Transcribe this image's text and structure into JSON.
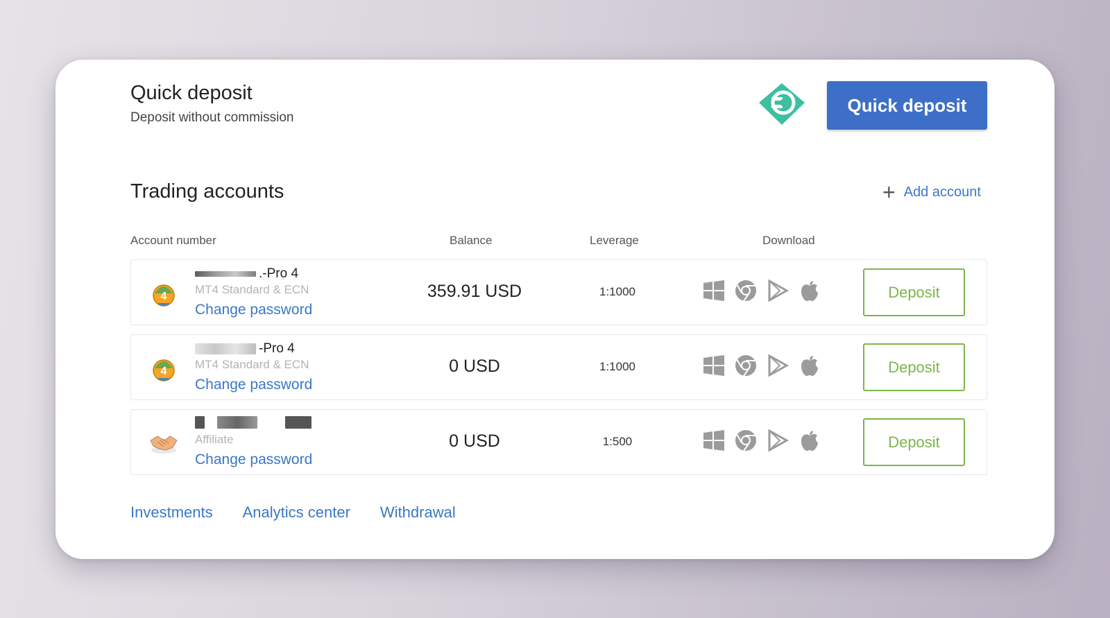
{
  "quick_deposit": {
    "title": "Quick deposit",
    "subtitle": "Deposit without commission",
    "button_label": "Quick deposit"
  },
  "trading": {
    "title": "Trading accounts",
    "add_account_label": "Add account",
    "columns": [
      "Account number",
      "Balance",
      "Leverage",
      "Download"
    ],
    "rows": [
      {
        "icon": "mt4-icon",
        "name_suffix": ".-Pro 4",
        "type": "MT4 Standard & ECN",
        "change_password": "Change password",
        "balance": "359.91 USD",
        "leverage": "1:1000",
        "deposit_label": "Deposit"
      },
      {
        "icon": "mt4-icon",
        "name_suffix": "-Pro 4",
        "type": "MT4 Standard & ECN",
        "change_password": "Change password",
        "balance": "0 USD",
        "leverage": "1:1000",
        "deposit_label": "Deposit"
      },
      {
        "icon": "handshake-icon",
        "name_suffix": "",
        "type": "Affiliate",
        "change_password": "Change password",
        "balance": "0 USD",
        "leverage": "1:500",
        "deposit_label": "Deposit"
      }
    ],
    "download_icons": [
      "windows-icon",
      "chrome-icon",
      "play-store-icon",
      "apple-icon"
    ]
  },
  "bottom_links": [
    "Investments",
    "Analytics center",
    "Withdrawal"
  ],
  "colors": {
    "primary_blue": "#3d6fc8",
    "link_blue": "#3978c7",
    "deposit_green": "#7ab648",
    "logo_teal": "#3dbfa0"
  }
}
